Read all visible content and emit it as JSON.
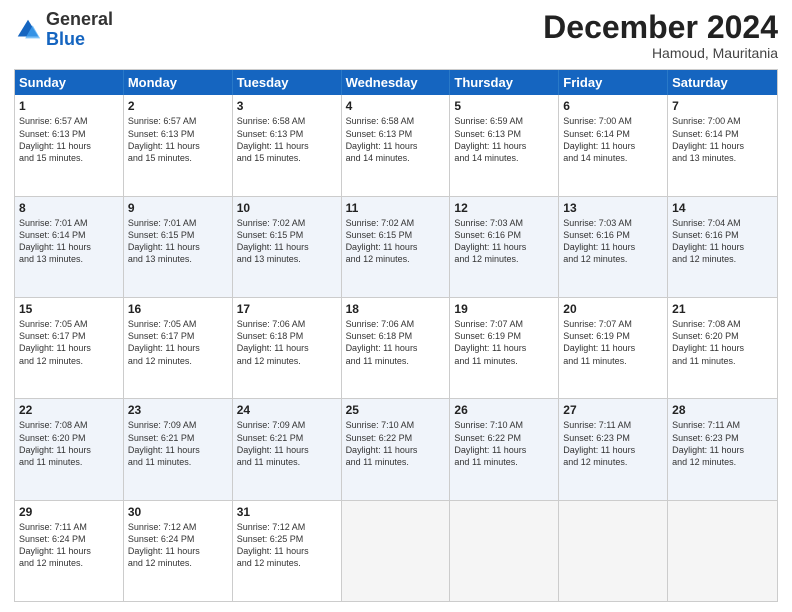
{
  "logo": {
    "general": "General",
    "blue": "Blue"
  },
  "title": "December 2024",
  "location": "Hamoud, Mauritania",
  "header_days": [
    "Sunday",
    "Monday",
    "Tuesday",
    "Wednesday",
    "Thursday",
    "Friday",
    "Saturday"
  ],
  "rows": [
    [
      {
        "day": "1",
        "lines": [
          "Sunrise: 6:57 AM",
          "Sunset: 6:13 PM",
          "Daylight: 11 hours",
          "and 15 minutes."
        ]
      },
      {
        "day": "2",
        "lines": [
          "Sunrise: 6:57 AM",
          "Sunset: 6:13 PM",
          "Daylight: 11 hours",
          "and 15 minutes."
        ]
      },
      {
        "day": "3",
        "lines": [
          "Sunrise: 6:58 AM",
          "Sunset: 6:13 PM",
          "Daylight: 11 hours",
          "and 15 minutes."
        ]
      },
      {
        "day": "4",
        "lines": [
          "Sunrise: 6:58 AM",
          "Sunset: 6:13 PM",
          "Daylight: 11 hours",
          "and 14 minutes."
        ]
      },
      {
        "day": "5",
        "lines": [
          "Sunrise: 6:59 AM",
          "Sunset: 6:13 PM",
          "Daylight: 11 hours",
          "and 14 minutes."
        ]
      },
      {
        "day": "6",
        "lines": [
          "Sunrise: 7:00 AM",
          "Sunset: 6:14 PM",
          "Daylight: 11 hours",
          "and 14 minutes."
        ]
      },
      {
        "day": "7",
        "lines": [
          "Sunrise: 7:00 AM",
          "Sunset: 6:14 PM",
          "Daylight: 11 hours",
          "and 13 minutes."
        ]
      }
    ],
    [
      {
        "day": "8",
        "lines": [
          "Sunrise: 7:01 AM",
          "Sunset: 6:14 PM",
          "Daylight: 11 hours",
          "and 13 minutes."
        ]
      },
      {
        "day": "9",
        "lines": [
          "Sunrise: 7:01 AM",
          "Sunset: 6:15 PM",
          "Daylight: 11 hours",
          "and 13 minutes."
        ]
      },
      {
        "day": "10",
        "lines": [
          "Sunrise: 7:02 AM",
          "Sunset: 6:15 PM",
          "Daylight: 11 hours",
          "and 13 minutes."
        ]
      },
      {
        "day": "11",
        "lines": [
          "Sunrise: 7:02 AM",
          "Sunset: 6:15 PM",
          "Daylight: 11 hours",
          "and 12 minutes."
        ]
      },
      {
        "day": "12",
        "lines": [
          "Sunrise: 7:03 AM",
          "Sunset: 6:16 PM",
          "Daylight: 11 hours",
          "and 12 minutes."
        ]
      },
      {
        "day": "13",
        "lines": [
          "Sunrise: 7:03 AM",
          "Sunset: 6:16 PM",
          "Daylight: 11 hours",
          "and 12 minutes."
        ]
      },
      {
        "day": "14",
        "lines": [
          "Sunrise: 7:04 AM",
          "Sunset: 6:16 PM",
          "Daylight: 11 hours",
          "and 12 minutes."
        ]
      }
    ],
    [
      {
        "day": "15",
        "lines": [
          "Sunrise: 7:05 AM",
          "Sunset: 6:17 PM",
          "Daylight: 11 hours",
          "and 12 minutes."
        ]
      },
      {
        "day": "16",
        "lines": [
          "Sunrise: 7:05 AM",
          "Sunset: 6:17 PM",
          "Daylight: 11 hours",
          "and 12 minutes."
        ]
      },
      {
        "day": "17",
        "lines": [
          "Sunrise: 7:06 AM",
          "Sunset: 6:18 PM",
          "Daylight: 11 hours",
          "and 12 minutes."
        ]
      },
      {
        "day": "18",
        "lines": [
          "Sunrise: 7:06 AM",
          "Sunset: 6:18 PM",
          "Daylight: 11 hours",
          "and 11 minutes."
        ]
      },
      {
        "day": "19",
        "lines": [
          "Sunrise: 7:07 AM",
          "Sunset: 6:19 PM",
          "Daylight: 11 hours",
          "and 11 minutes."
        ]
      },
      {
        "day": "20",
        "lines": [
          "Sunrise: 7:07 AM",
          "Sunset: 6:19 PM",
          "Daylight: 11 hours",
          "and 11 minutes."
        ]
      },
      {
        "day": "21",
        "lines": [
          "Sunrise: 7:08 AM",
          "Sunset: 6:20 PM",
          "Daylight: 11 hours",
          "and 11 minutes."
        ]
      }
    ],
    [
      {
        "day": "22",
        "lines": [
          "Sunrise: 7:08 AM",
          "Sunset: 6:20 PM",
          "Daylight: 11 hours",
          "and 11 minutes."
        ]
      },
      {
        "day": "23",
        "lines": [
          "Sunrise: 7:09 AM",
          "Sunset: 6:21 PM",
          "Daylight: 11 hours",
          "and 11 minutes."
        ]
      },
      {
        "day": "24",
        "lines": [
          "Sunrise: 7:09 AM",
          "Sunset: 6:21 PM",
          "Daylight: 11 hours",
          "and 11 minutes."
        ]
      },
      {
        "day": "25",
        "lines": [
          "Sunrise: 7:10 AM",
          "Sunset: 6:22 PM",
          "Daylight: 11 hours",
          "and 11 minutes."
        ]
      },
      {
        "day": "26",
        "lines": [
          "Sunrise: 7:10 AM",
          "Sunset: 6:22 PM",
          "Daylight: 11 hours",
          "and 11 minutes."
        ]
      },
      {
        "day": "27",
        "lines": [
          "Sunrise: 7:11 AM",
          "Sunset: 6:23 PM",
          "Daylight: 11 hours",
          "and 12 minutes."
        ]
      },
      {
        "day": "28",
        "lines": [
          "Sunrise: 7:11 AM",
          "Sunset: 6:23 PM",
          "Daylight: 11 hours",
          "and 12 minutes."
        ]
      }
    ],
    [
      {
        "day": "29",
        "lines": [
          "Sunrise: 7:11 AM",
          "Sunset: 6:24 PM",
          "Daylight: 11 hours",
          "and 12 minutes."
        ]
      },
      {
        "day": "30",
        "lines": [
          "Sunrise: 7:12 AM",
          "Sunset: 6:24 PM",
          "Daylight: 11 hours",
          "and 12 minutes."
        ]
      },
      {
        "day": "31",
        "lines": [
          "Sunrise: 7:12 AM",
          "Sunset: 6:25 PM",
          "Daylight: 11 hours",
          "and 12 minutes."
        ]
      },
      {
        "day": "",
        "lines": []
      },
      {
        "day": "",
        "lines": []
      },
      {
        "day": "",
        "lines": []
      },
      {
        "day": "",
        "lines": []
      }
    ]
  ]
}
